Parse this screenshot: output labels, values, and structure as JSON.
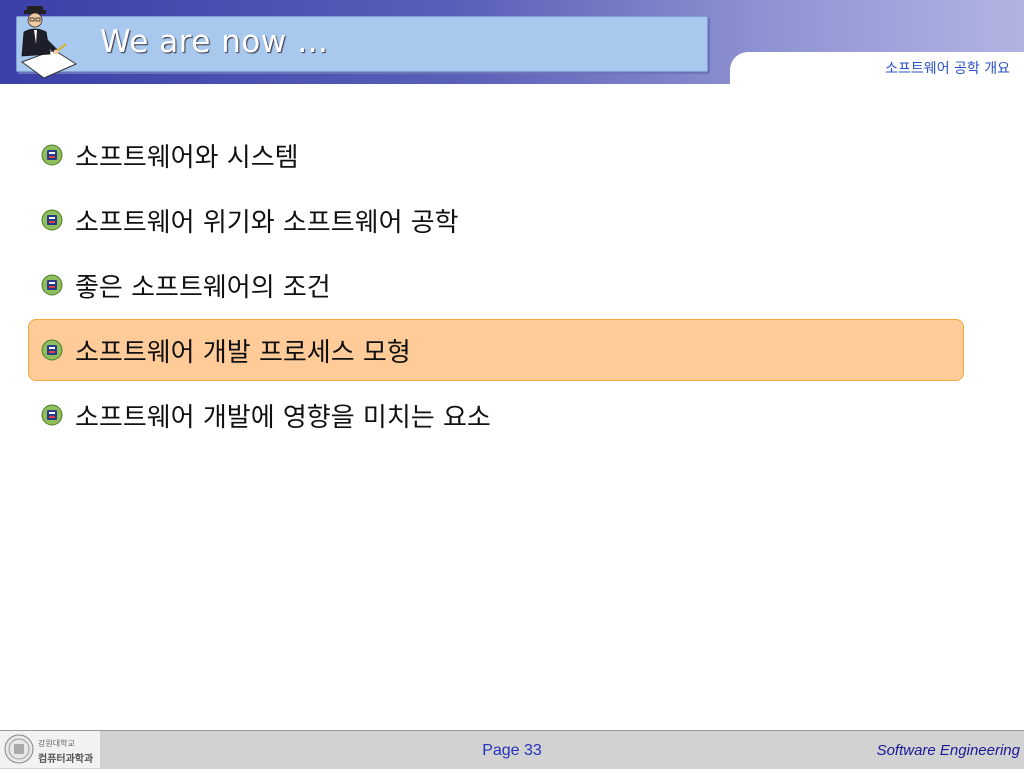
{
  "header": {
    "title": "We are now …",
    "section_label": "소프트웨어 공학 개요"
  },
  "menu": {
    "items": [
      {
        "label": "소프트웨어와 시스템",
        "active": false
      },
      {
        "label": "소프트웨어 위기와 소프트웨어 공학",
        "active": false
      },
      {
        "label": "좋은 소프트웨어의 조건",
        "active": false
      },
      {
        "label": "소프트웨어 개발 프로세스 모형",
        "active": true
      },
      {
        "label": "소프트웨어 개발에 영향을 미치는 요소",
        "active": false
      }
    ]
  },
  "footer": {
    "logo_line1": "강원대학교",
    "logo_line2": "컴퓨터과학과",
    "page": "Page 33",
    "course": "Software Engineering"
  },
  "colors": {
    "header_band": "#3b3fa8",
    "title_box": "#a8c8ee",
    "active_highlight": "#ffcc99",
    "active_border": "#f4a640",
    "section_label": "#2850c8",
    "page_number": "#2233bb"
  },
  "icons": {
    "clipart": "businessman-writing-icon",
    "bullet": "university-emblem-icon",
    "logo": "university-seal-icon"
  }
}
